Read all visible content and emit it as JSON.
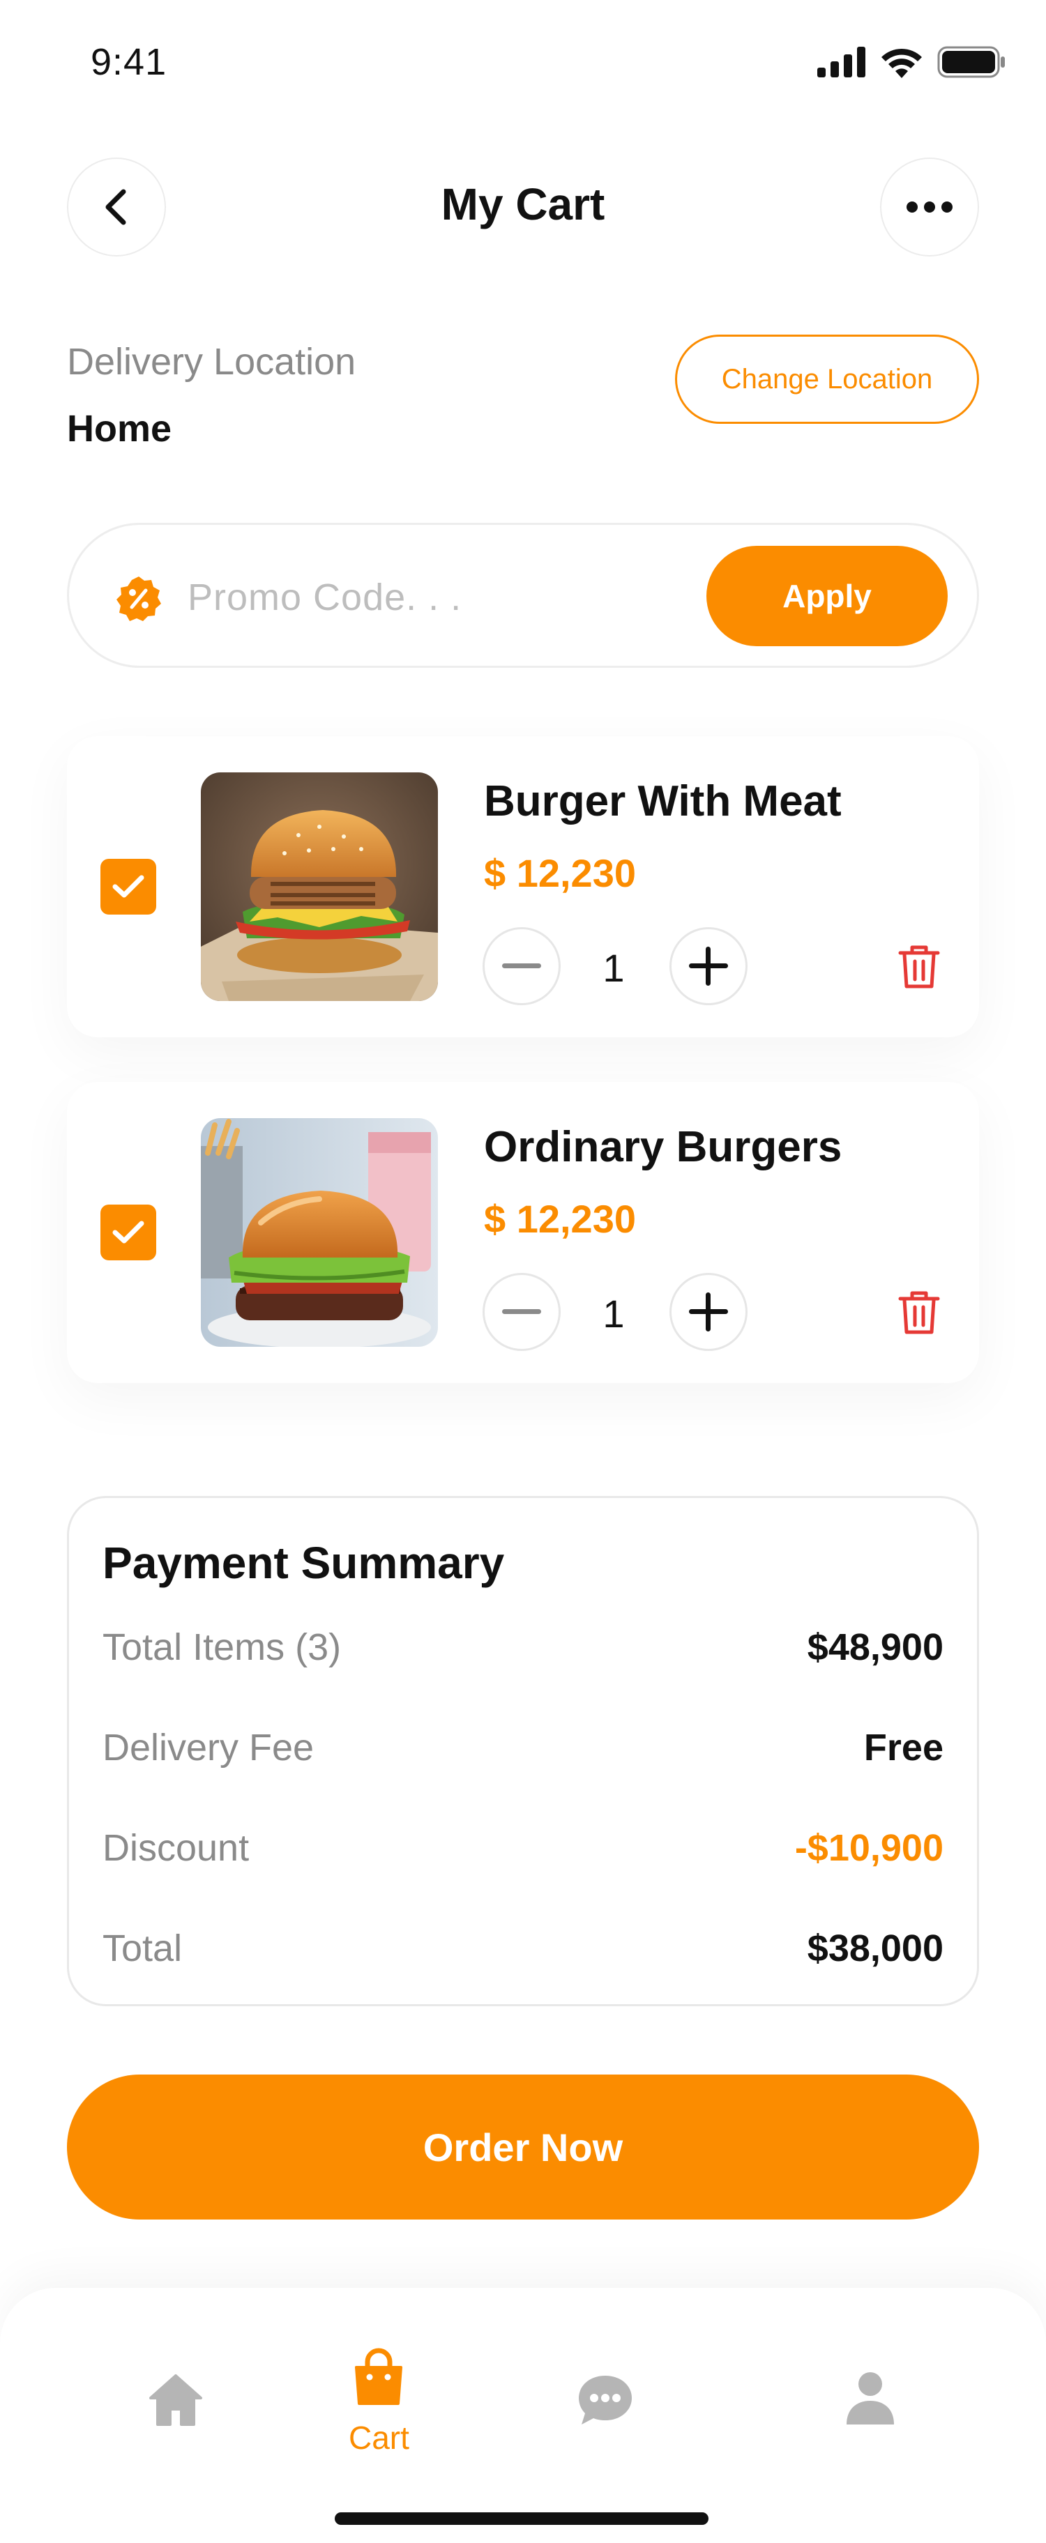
{
  "status_bar": {
    "time": "9:41",
    "icons": [
      "cellular-icon",
      "wifi-icon",
      "battery-icon"
    ]
  },
  "header": {
    "title": "My Cart",
    "back_icon": "chevron-left-icon",
    "more_icon": "more-horizontal-icon"
  },
  "delivery": {
    "label": "Delivery Location",
    "value": "Home",
    "change_button": "Change Location"
  },
  "promo": {
    "icon": "discount-badge-icon",
    "placeholder": "Promo Code. . .",
    "value": "",
    "apply_button": "Apply"
  },
  "cart": {
    "items": [
      {
        "name": "Burger With Meat",
        "price": "$ 12,230",
        "quantity": "1",
        "checked": true,
        "image": "burger-with-meat-photo"
      },
      {
        "name": "Ordinary Burgers",
        "price": "$ 12,230",
        "quantity": "1",
        "checked": true,
        "image": "ordinary-burgers-photo"
      }
    ]
  },
  "payment_summary": {
    "title": "Payment Summary",
    "rows": [
      {
        "label": "Total Items (3)",
        "value": "$48,900"
      },
      {
        "label": "Delivery Fee",
        "value": "Free"
      },
      {
        "label": "Discount",
        "value": "-$10,900"
      },
      {
        "label": "Total",
        "value": "$38,000"
      }
    ]
  },
  "order_button": "Order Now",
  "bottom_nav": {
    "items": [
      {
        "icon": "home-icon",
        "label": "",
        "active": false
      },
      {
        "icon": "shopping-bag-icon",
        "label": "Cart",
        "active": true
      },
      {
        "icon": "chat-icon",
        "label": "",
        "active": false
      },
      {
        "icon": "profile-icon",
        "label": "",
        "active": false
      }
    ]
  },
  "colors": {
    "accent": "#fb8c00",
    "danger": "#e53935",
    "muted_text": "#8a8a8a",
    "inactive_icon": "#b5b5b5"
  }
}
